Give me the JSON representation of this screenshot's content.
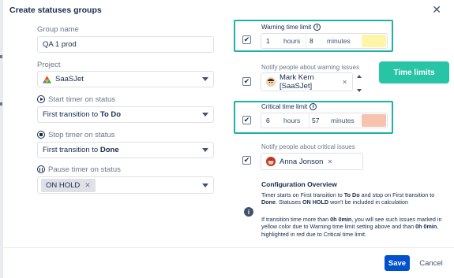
{
  "dialog": {
    "title": "Create statuses groups",
    "close_icon": "close-icon"
  },
  "group_name": {
    "label": "Group name",
    "value": "QA 1 prod"
  },
  "project": {
    "label": "Project",
    "value": "SaaSJet",
    "icon": "saasjet-logo-icon"
  },
  "start_timer": {
    "label": "Start timer on status",
    "icon": "play-circle-icon",
    "prefix": "First transition to",
    "status": "To Do"
  },
  "stop_timer": {
    "label": "Stop timer on status",
    "icon": "stop-circle-icon",
    "prefix": "First transition to",
    "status": "Done"
  },
  "pause_timer": {
    "label": "Pause timer on status",
    "icon": "pause-circle-icon",
    "chip": "ON HOLD",
    "chip_remove": "✕"
  },
  "warning": {
    "label": "Warning time limit",
    "hours_value": "1",
    "hours_unit": "hours",
    "minutes_value": "8",
    "minutes_unit": "minutes",
    "color": "#fff5a8",
    "checked": "✔"
  },
  "notify_warning": {
    "label": "Notify people about warning issues",
    "user": "Mark Kern [SaaSJet]",
    "remove": "✕",
    "checked": "✔"
  },
  "critical": {
    "label": "Critical time limit",
    "hours_value": "6",
    "hours_unit": "hours",
    "minutes_value": "57",
    "minutes_unit": "minutes",
    "color": "#f7c3ae",
    "checked": "✔"
  },
  "notify_critical": {
    "label": "Notify people about critical issues",
    "user": "Anna Jonson",
    "remove": "✕",
    "checked": "✔"
  },
  "time_limits_button": {
    "label": "Time limits",
    "color": "#27c4a6"
  },
  "overview": {
    "title": "Configuration Overview",
    "p1_parts": [
      "Timer starts on First transition to ",
      "To Do",
      " and stop on First transition to ",
      "Done",
      ". Statuses ",
      "ON HOLD",
      " won't be included in calculation"
    ],
    "p2_parts": [
      "If transition time more than ",
      "0h 0min",
      ", you will see such issues marked in yellow color due to Warning time limit setting above and than ",
      "0h 0min",
      ", highlighted in red due to Critical time limit."
    ],
    "info_icon": "info-icon"
  },
  "footer": {
    "save": "Save",
    "cancel": "Cancel"
  },
  "colors": {
    "accent": "#0052cc",
    "teal": "#1fb1a5",
    "time_limits": "#27c4a6"
  }
}
